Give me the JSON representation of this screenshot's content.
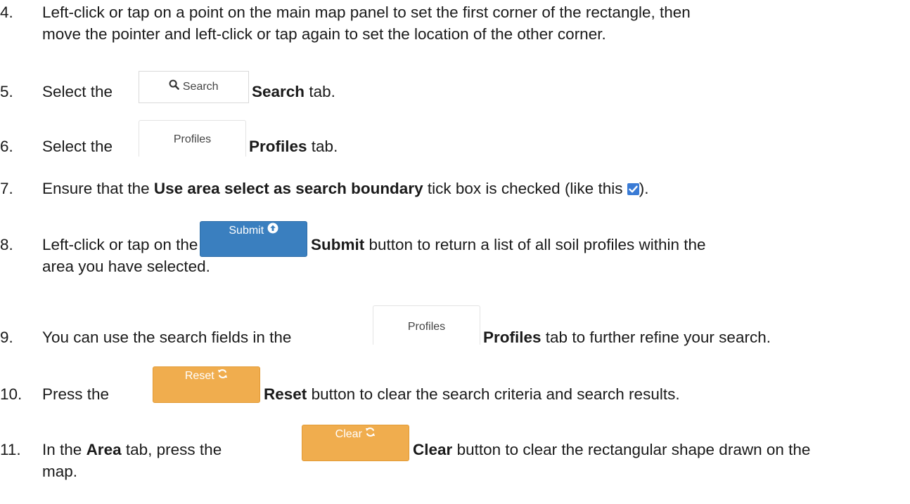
{
  "steps": [
    {
      "num": "4.",
      "line1": "Left-click or tap on a point on the main map panel to set the first corner of the rectangle, then",
      "line2": "move the pointer and left-click or tap again to set the location of the other corner."
    },
    {
      "num": "5.",
      "pre": "Select the",
      "button_label": "Search",
      "button_icon": "search-icon",
      "bold": "Search",
      "post": "tab."
    },
    {
      "num": "6.",
      "pre": "Select the",
      "button_label": "Profiles",
      "bold": "Profiles",
      "post": "tab."
    },
    {
      "num": "7.",
      "pre": "Ensure that the",
      "bold": "Use area select as search boundary",
      "post": "tick box is checked (like this",
      "checkbox_icon": "checked-checkbox-icon",
      "end": ")."
    },
    {
      "num": "8.",
      "pre": "Left-click or tap on the",
      "button_label": "Submit",
      "button_icon": "circle-arrow-up-icon",
      "bold": "Submit",
      "post": "button to return a list of all soil profiles within the",
      "line2": "area you have selected."
    },
    {
      "num": "9.",
      "pre": "You can use the search fields in the",
      "button_label": "Profiles",
      "bold": "Profiles",
      "post": "tab to further refine your search."
    },
    {
      "num": "10.",
      "pre": "Press the",
      "button_label": "Reset",
      "button_icon": "refresh-icon",
      "bold": "Reset",
      "post": "button to clear the search criteria and search results."
    },
    {
      "num": "11.",
      "pre": "In the",
      "bold_a": "Area",
      "mid": "tab, press the",
      "button_label": "Clear",
      "button_icon": "refresh-icon",
      "bold": "Clear",
      "post": "button to clear the rectangular shape drawn on the",
      "line2": "map."
    }
  ],
  "colors": {
    "primary_button": "#3a7fbf",
    "warning_button": "#f0ad4e",
    "checkbox": "#3a7bd5",
    "text": "#1a1a1a"
  }
}
